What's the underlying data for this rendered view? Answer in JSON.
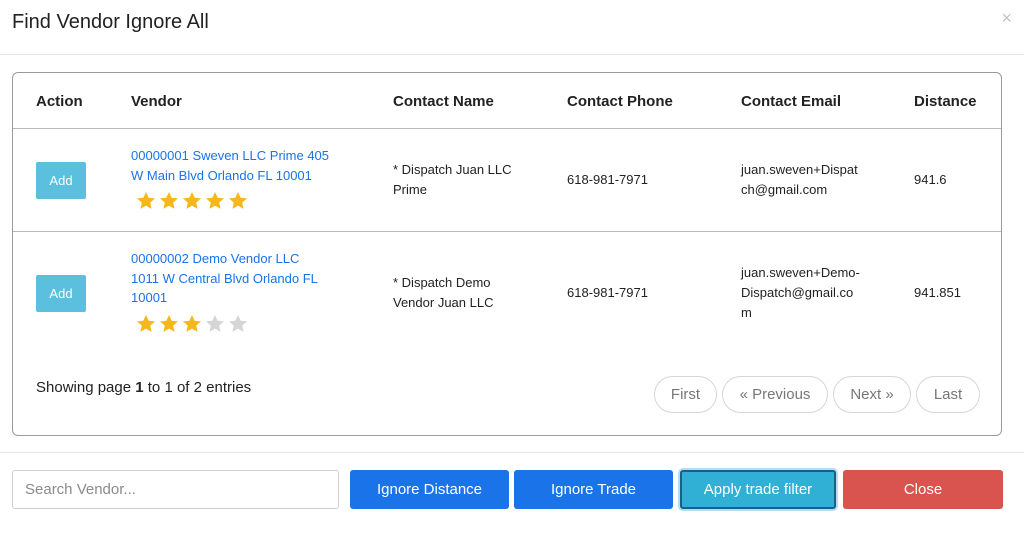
{
  "modal": {
    "title": "Find Vendor Ignore All",
    "close_glyph": "×"
  },
  "table": {
    "headers": [
      "Action",
      "Vendor",
      "Contact Name",
      "Contact Phone",
      "Contact Email",
      "Distance"
    ],
    "rows": [
      {
        "action": "Add",
        "vendor_line1": "00000001 Sweven LLC Prime 405",
        "vendor_line2": "W Main Blvd Orlando FL 10001",
        "rating": 5,
        "contact_name_line1": "* Dispatch Juan LLC",
        "contact_name_line2": "Prime",
        "phone": "618-981-7971",
        "email_line1": "juan.sweven+Dispat",
        "email_line2": "ch@gmail.com",
        "distance": "941.6"
      },
      {
        "action": "Add",
        "vendor_line1": "00000002 Demo Vendor LLC",
        "vendor_line2": "1011 W Central Blvd Orlando FL",
        "vendor_line3": "10001",
        "rating": 3,
        "contact_name_line1": "* Dispatch Demo",
        "contact_name_line2": "Vendor Juan LLC",
        "phone": "618-981-7971",
        "email_line1": "juan.sweven+Demo-",
        "email_line2": "Dispatch@gmail.co",
        "email_line3": "m",
        "distance": "941.851"
      }
    ],
    "max_rating": 5,
    "info_prefix": "Showing page ",
    "info_page": "1",
    "info_suffix": " to 1 of 2 entries"
  },
  "pagination": {
    "first": "First",
    "previous": "« Previous",
    "next": "Next »",
    "last": "Last"
  },
  "footer": {
    "search_placeholder": "Search Vendor...",
    "ignore_distance": "Ignore Distance",
    "ignore_trade": "Ignore Trade",
    "apply_trade_filter": "Apply trade filter",
    "close": "Close"
  },
  "colors": {
    "primary": "#1a73e8",
    "info": "#5bc0de",
    "apply": "#31b0d5",
    "danger": "#d9534f",
    "star_filled": "#f5b71b",
    "star_empty": "#d5d5d5"
  }
}
